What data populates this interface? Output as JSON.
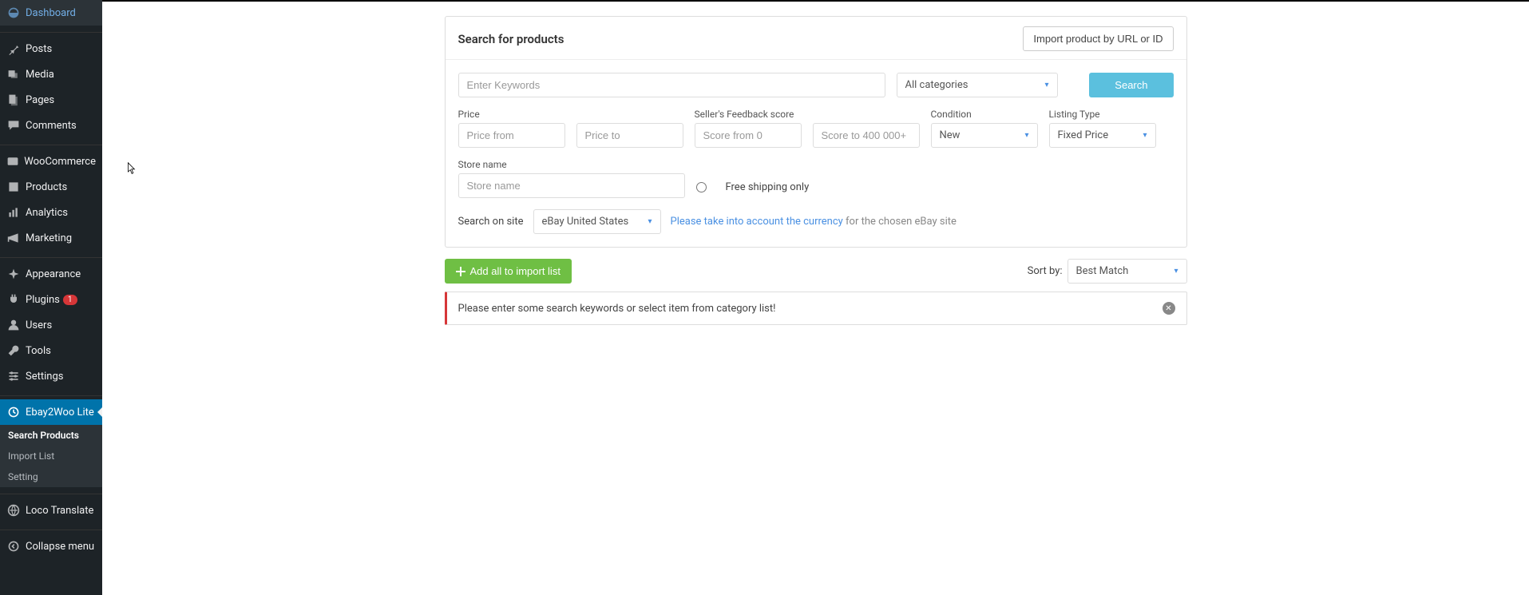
{
  "sidebar": {
    "items": [
      {
        "label": "Dashboard"
      },
      {
        "label": "Posts"
      },
      {
        "label": "Media"
      },
      {
        "label": "Pages"
      },
      {
        "label": "Comments"
      },
      {
        "label": "WooCommerce"
      },
      {
        "label": "Products"
      },
      {
        "label": "Analytics"
      },
      {
        "label": "Marketing"
      },
      {
        "label": "Appearance"
      },
      {
        "label": "Plugins",
        "badge": "1"
      },
      {
        "label": "Users"
      },
      {
        "label": "Tools"
      },
      {
        "label": "Settings"
      },
      {
        "label": "Ebay2Woo Lite"
      },
      {
        "label": "Loco Translate"
      },
      {
        "label": "Collapse menu"
      }
    ],
    "sub": [
      {
        "label": "Search Products"
      },
      {
        "label": "Import List"
      },
      {
        "label": "Setting"
      }
    ]
  },
  "header": {
    "title": "Search for products",
    "import_btn": "Import product by URL or ID"
  },
  "search": {
    "keywords_placeholder": "Enter Keywords",
    "category": "All categories",
    "search_btn": "Search",
    "price_label": "Price",
    "price_from_placeholder": "Price from",
    "price_to_placeholder": "Price to",
    "feedback_label": "Seller's Feedback score",
    "score_from_placeholder": "Score from 0",
    "score_to_placeholder": "Score to 400 000+",
    "condition_label": "Condition",
    "condition_value": "New",
    "listing_label": "Listing Type",
    "listing_value": "Fixed Price",
    "store_label": "Store name",
    "store_placeholder": "Store name",
    "free_shipping_label": "Free shipping only",
    "search_on_site_label": "Search on site",
    "site_value": "eBay United States",
    "hint_link": "Please take into account the currency",
    "hint_rest": " for the chosen eBay site"
  },
  "toolbar": {
    "add_all_btn": "Add all to import list",
    "sort_by_label": "Sort by:",
    "sort_value": "Best Match"
  },
  "alert": {
    "message": "Please enter some search keywords or select item from category list!"
  }
}
